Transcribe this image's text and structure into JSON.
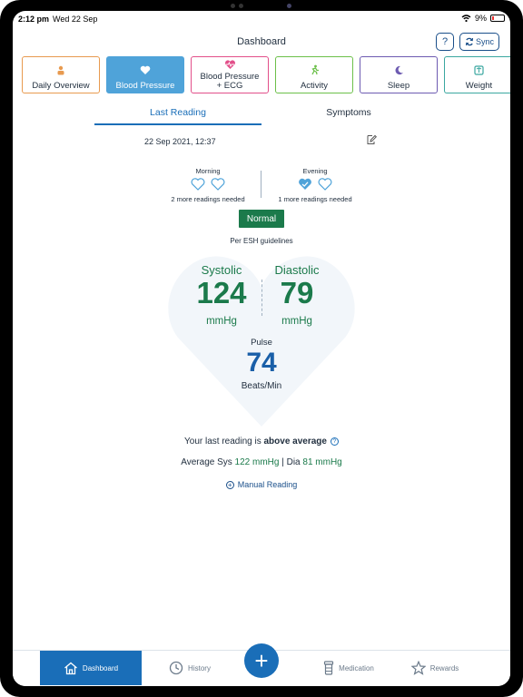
{
  "status_bar": {
    "time": "2:12 pm",
    "date": "Wed 22 Sep",
    "battery": "9%"
  },
  "header": {
    "title": "Dashboard",
    "help_label": "?",
    "sync_label": "Sync"
  },
  "categories": [
    {
      "label": "Daily Overview",
      "icon": "person-icon"
    },
    {
      "label": "Blood Pressure",
      "icon": "heart-icon",
      "selected": true
    },
    {
      "label": "Blood Pressure + ECG",
      "icon": "heart-ecg-icon"
    },
    {
      "label": "Activity",
      "icon": "activity-icon"
    },
    {
      "label": "Sleep",
      "icon": "moon-icon"
    },
    {
      "label": "Weight",
      "icon": "scale-icon"
    }
  ],
  "subtabs": {
    "last_reading": "Last Reading",
    "symptoms": "Symptoms"
  },
  "reading": {
    "datetime": "22 Sep 2021, 12:37",
    "morning": {
      "label": "Morning",
      "note": "2 more readings needed"
    },
    "evening": {
      "label": "Evening",
      "note": "1 more readings needed"
    },
    "status": "Normal",
    "guideline": "Per ESH guidelines",
    "systolic": {
      "label": "Systolic",
      "value": "124",
      "unit": "mmHg"
    },
    "diastolic": {
      "label": "Diastolic",
      "value": "79",
      "unit": "mmHg"
    },
    "pulse": {
      "label": "Pulse",
      "value": "74",
      "unit": "Beats/Min"
    }
  },
  "summary": {
    "prefix": "Your last reading is ",
    "emphasis": "above average",
    "avg_prefix": "Average Sys ",
    "avg_sys": "122 mmHg",
    "avg_sep": " | Dia ",
    "avg_dia": "81 mmHg",
    "manual": "Manual Reading"
  },
  "nav": {
    "dashboard": "Dashboard",
    "history": "History",
    "add": "+",
    "medication": "Medication",
    "rewards": "Rewards"
  },
  "colors": {
    "accent": "#1a6eb8",
    "normal_green": "#1b7a4b",
    "heart_bg": "#f2f6fa"
  }
}
